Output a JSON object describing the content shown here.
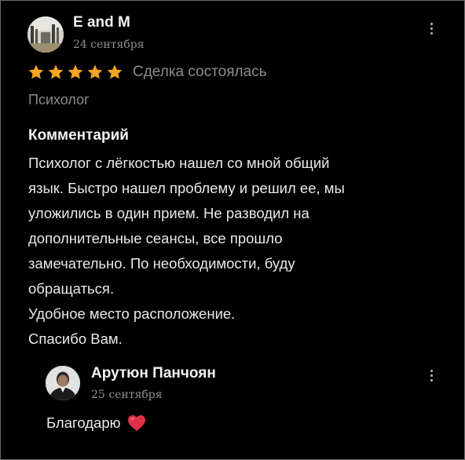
{
  "review": {
    "author": "E and M",
    "date": "24 сентября",
    "rating": 5,
    "rating_max": 5,
    "deal_status": "Сделка состоялась",
    "category": "Психолог",
    "comment_heading": "Комментарий",
    "comment_lines": [
      "Психолог с лёгкостью нашел со мной общий",
      "язык. Быстро нашел проблему и решил ее, мы",
      "уложились в один прием. Не разводил на",
      "дополнительные сеансы, все прошло",
      "замечательно. По необходимости, буду",
      "обращаться.",
      "Удобное место расположение.",
      "Спасибо Вам."
    ]
  },
  "reply": {
    "author": "Арутюн Панчоян",
    "date": "25 сентября",
    "text": "Благодарю"
  },
  "icons": {
    "star": "star-icon",
    "heart": "heart-icon",
    "menu": "kebab-menu-icon"
  },
  "colors": {
    "background": "#000000",
    "star": "#f5a623",
    "heart": "#e0314b",
    "muted_text": "#8d8d8d"
  }
}
